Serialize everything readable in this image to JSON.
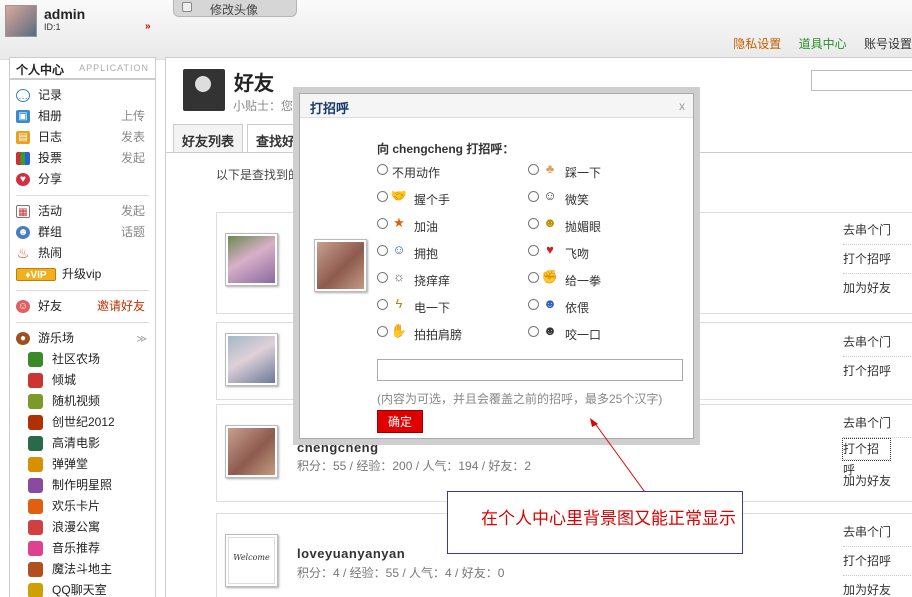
{
  "topbar": {
    "username": "admin",
    "user_id": "ID:1",
    "arrows": "»",
    "tab_label": "修改头像",
    "links": [
      {
        "label": "隐私设置",
        "color": "#c06000"
      },
      {
        "label": "道具中心",
        "color": "#2a8f2a"
      },
      {
        "label": "账号设置",
        "color": "#333333"
      }
    ]
  },
  "sidebar": {
    "title": "个人中心",
    "subtitle": "APPLICATION",
    "items": [
      {
        "label": "记录",
        "extra": "",
        "icon": "message-icon"
      },
      {
        "label": "相册",
        "extra": "上传",
        "icon": "photo-icon"
      },
      {
        "label": "日志",
        "extra": "发表",
        "icon": "blog-icon"
      },
      {
        "label": "投票",
        "extra": "发起",
        "icon": "poll-icon"
      },
      {
        "label": "分享",
        "extra": "",
        "icon": "share-icon"
      }
    ],
    "items2": [
      {
        "label": "活动",
        "extra": "发起",
        "icon": "event-icon"
      },
      {
        "label": "群组",
        "extra": "话题",
        "icon": "group-icon"
      },
      {
        "label": "热闹",
        "extra": "",
        "icon": "fire-icon"
      },
      {
        "label": "升级vip",
        "extra": "",
        "icon": "vip-icon"
      }
    ],
    "friends": {
      "label": "好友",
      "extra": "邀请好友"
    },
    "games_title": "游乐场",
    "games": [
      {
        "label": "社区农场",
        "color": "#3a8a2a"
      },
      {
        "label": "倾城",
        "color": "#c33"
      },
      {
        "label": "随机视频",
        "color": "#7a9a2a"
      },
      {
        "label": "创世纪2012",
        "color": "#b03000"
      },
      {
        "label": "高清电影",
        "color": "#2a6a4a"
      },
      {
        "label": "弹弹堂",
        "color": "#d89000"
      },
      {
        "label": "制作明星照",
        "color": "#8a4aa0"
      },
      {
        "label": "欢乐卡片",
        "color": "#e06010"
      },
      {
        "label": "浪漫公寓",
        "color": "#d04040"
      },
      {
        "label": "音乐推荐",
        "color": "#e04090"
      },
      {
        "label": "魔法斗地主",
        "color": "#b05020"
      },
      {
        "label": "QQ聊天室",
        "color": "#d0a000"
      }
    ]
  },
  "main": {
    "title": "好友",
    "tip": "小贴士：您",
    "tabs": [
      "好友列表",
      "查找好"
    ],
    "intro": "以下是查找到的",
    "cards": [
      {
        "name": "",
        "stats": "",
        "actions": [
          "去串个门",
          "打个招呼",
          "加为好友"
        ]
      },
      {
        "name": "",
        "stats": "",
        "actions": [
          "去串个门",
          "打个招呼"
        ]
      },
      {
        "name": "chengcheng",
        "stats": "积分：55 / 经验：200 / 人气：194 / 好友：2",
        "actions": [
          "去串个门",
          "打个招呼",
          "加为好友"
        ]
      },
      {
        "name": "loveyuanyanyan",
        "stats": "积分：4 / 经验：55 / 人气：4 / 好友：0",
        "actions": [
          "去串个门",
          "打个招呼",
          "加为好友"
        ]
      }
    ]
  },
  "dialog": {
    "title": "打招呼",
    "close": "x",
    "greet": "向 chengcheng 打招呼：",
    "actions_left": [
      {
        "label": "不用动作",
        "icon": ""
      },
      {
        "label": "握个手",
        "icon": "handshake-icon"
      },
      {
        "label": "加油",
        "icon": "cheer-icon"
      },
      {
        "label": "拥抱",
        "icon": "hug-icon"
      },
      {
        "label": "挠痒痒",
        "icon": "tickle-icon"
      },
      {
        "label": "电一下",
        "icon": "lightning-icon"
      },
      {
        "label": "拍拍肩膀",
        "icon": "pat-icon"
      }
    ],
    "actions_right": [
      {
        "label": "踩一下",
        "icon": "footprint-icon"
      },
      {
        "label": "微笑",
        "icon": "smile-icon"
      },
      {
        "label": "抛媚眼",
        "icon": "wink-icon"
      },
      {
        "label": "飞吻",
        "icon": "kiss-icon"
      },
      {
        "label": "给一拳",
        "icon": "punch-icon"
      },
      {
        "label": "依偎",
        "icon": "cuddle-icon"
      },
      {
        "label": "咬一口",
        "icon": "bite-icon"
      }
    ],
    "note": "(内容为可选，并且会覆盖之前的招呼，最多25个汉字)",
    "ok_label": "确定"
  },
  "annotation": {
    "text": "在个人中心里背景图又能正常显示"
  }
}
